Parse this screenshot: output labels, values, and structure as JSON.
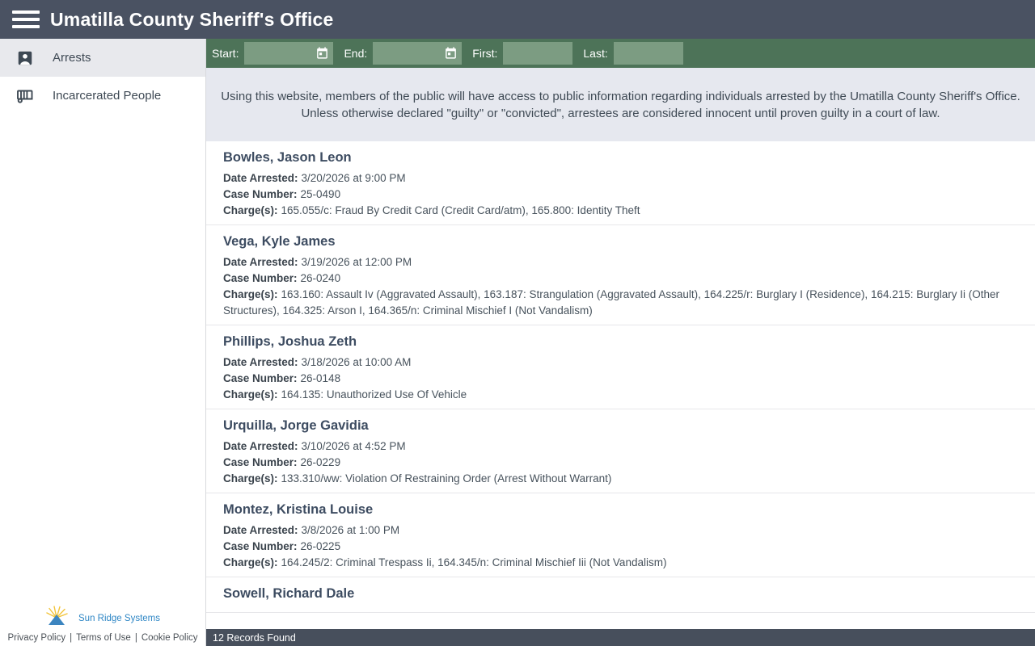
{
  "header": {
    "title": "Umatilla County Sheriff's Office"
  },
  "sidebar": {
    "items": [
      {
        "label": "Arrests",
        "icon": "person-badge-icon",
        "selected": true
      },
      {
        "label": "Incarcerated People",
        "icon": "jail-transport-icon",
        "selected": false
      }
    ],
    "footer": {
      "logo_text": "Sun Ridge Systems",
      "links": [
        "Privacy Policy",
        "Terms of Use",
        "Cookie Policy"
      ],
      "separator": "|"
    }
  },
  "filters": {
    "start_label": "Start:",
    "start_value": "",
    "end_label": "End:",
    "end_value": "",
    "first_label": "First:",
    "first_value": "",
    "last_label": "Last:",
    "last_value": ""
  },
  "disclaimer": "Using this website, members of the public will have access to public information regarding individuals arrested by the Umatilla County Sheriff's Office. Unless otherwise declared \"guilty\" or \"convicted\", arrestees are considered innocent until proven guilty in a court of law.",
  "labels": {
    "date_arrested": "Date Arrested:",
    "case_number": "Case Number:",
    "charges": "Charge(s):"
  },
  "records": [
    {
      "name": "Bowles, Jason Leon",
      "date_arrested": "3/20/2026 at 9:00 PM",
      "case_number": "25-0490",
      "charges": "165.055/c: Fraud By Credit Card (Credit Card/atm), 165.800: Identity Theft"
    },
    {
      "name": "Vega, Kyle James",
      "date_arrested": "3/19/2026 at 12:00 PM",
      "case_number": "26-0240",
      "charges": "163.160: Assault Iv (Aggravated Assault), 163.187: Strangulation (Aggravated Assault), 164.225/r: Burglary I (Residence), 164.215: Burglary Ii (Other Structures), 164.325: Arson I, 164.365/n: Criminal Mischief I (Not Vandalism)"
    },
    {
      "name": "Phillips, Joshua Zeth",
      "date_arrested": "3/18/2026 at 10:00 AM",
      "case_number": "26-0148",
      "charges": "164.135: Unauthorized Use Of Vehicle"
    },
    {
      "name": "Urquilla, Jorge Gavidia",
      "date_arrested": "3/10/2026 at 4:52 PM",
      "case_number": "26-0229",
      "charges": "133.310/ww: Violation Of Restraining Order (Arrest Without Warrant)"
    },
    {
      "name": "Montez, Kristina Louise",
      "date_arrested": "3/8/2026 at 1:00 PM",
      "case_number": "26-0225",
      "charges": "164.245/2: Criminal Trespass Ii, 164.345/n: Criminal Mischief Iii (Not Vandalism)"
    },
    {
      "name": "Sowell, Richard Dale"
    }
  ],
  "status_bar": {
    "text": "12 Records Found"
  },
  "colors": {
    "header_bg": "#4a5262",
    "status_bg": "#474f5c",
    "filter_bg": "#4d7358",
    "filter_input_bg": "#7c9c82",
    "disclaimer_bg": "#e6e8ef",
    "sidebar_selected_bg": "#e8e9ed",
    "name_color": "#3d4c61",
    "label_color": "#3a434c",
    "text_color": "#47525c",
    "brand_blue": "#2e86c5"
  }
}
